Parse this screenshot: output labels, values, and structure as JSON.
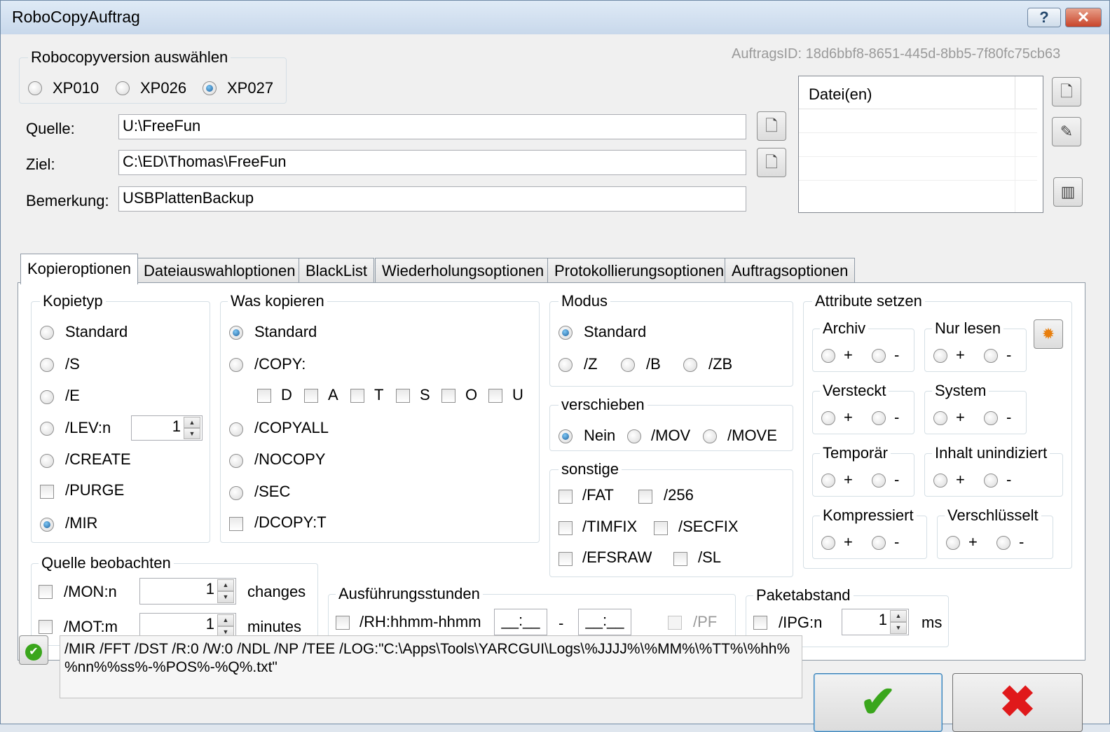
{
  "window": {
    "title": "RoboCopyAuftrag",
    "help_label": "?",
    "close_label": "✕"
  },
  "job_id": "AuftragsID: 18d6bbf8-8651-445d-8bb5-7f80fc75cb63",
  "version_group": {
    "label": "Robocopyversion auswählen",
    "options": [
      "XP010",
      "XP026",
      "XP027"
    ],
    "selected": "XP027"
  },
  "fields": {
    "source_label": "Quelle:",
    "source_value": "U:\\FreeFun",
    "target_label": "Ziel:",
    "target_value": "C:\\ED\\Thomas\\FreeFun",
    "remark_label": "Bemerkung:",
    "remark_value": "USBPlattenBackup"
  },
  "files": {
    "header": "Datei(en)"
  },
  "tabs": [
    "Kopieroptionen",
    "Dateiauswahloptionen",
    "BlackList",
    "Wiederholungsoptionen",
    "Protokollierungsoptionen",
    "Auftragsoptionen"
  ],
  "copy_type": {
    "label": "Kopietyp",
    "standard": "Standard",
    "s": "/S",
    "e": "/E",
    "lev": "/LEV:n",
    "lev_value": "1",
    "create": "/CREATE",
    "purge": "/PURGE",
    "mir": "/MIR",
    "selected": "/MIR"
  },
  "what_copy": {
    "label": "Was kopieren",
    "standard": "Standard",
    "copy": "/COPY:",
    "flags": [
      "D",
      "A",
      "T",
      "S",
      "O",
      "U"
    ],
    "copyall": "/COPYALL",
    "nocopy": "/NOCOPY",
    "sec": "/SEC",
    "dcopy": "/DCOPY:T",
    "selected": "Standard"
  },
  "mode": {
    "label": "Modus",
    "standard": "Standard",
    "z": "/Z",
    "b": "/B",
    "zb": "/ZB",
    "selected": "Standard"
  },
  "move": {
    "label": "verschieben",
    "nein": "Nein",
    "mov": "/MOV",
    "move": "/MOVE",
    "selected": "Nein"
  },
  "misc": {
    "label": "sonstige",
    "fat": "/FAT",
    "n256": "/256",
    "timfix": "/TIMFIX",
    "secfix": "/SECFIX",
    "efsraw": "/EFSRAW",
    "sl": "/SL"
  },
  "attributes": {
    "label": "Attribute setzen",
    "plus": "+",
    "minus": "-",
    "archiv": "Archiv",
    "readonly": "Nur lesen",
    "hidden": "Versteckt",
    "system": "System",
    "temp": "Temporär",
    "notindexed": "Inhalt unindiziert",
    "compressed": "Kompressiert",
    "encrypted": "Verschlüsselt",
    "reset_icon": "sparkle-icon"
  },
  "monitor": {
    "label": "Quelle beobachten",
    "mon": "/MON:n",
    "mon_value": "1",
    "mon_unit": "changes",
    "mot": "/MOT:m",
    "mot_value": "1",
    "mot_unit": "minutes"
  },
  "run_hours": {
    "label": "Ausführungsstunden",
    "rh": "/RH:hhmm-hhmm",
    "from": "__:__",
    "dash": "-",
    "to": "__:__",
    "pf": "/PF"
  },
  "packet": {
    "label": "Paketabstand",
    "ipg": "/IPG:n",
    "value": "1",
    "unit": "ms"
  },
  "command_line": "/MIR /FFT /DST /R:0 /W:0 /NDL /NP /TEE /LOG:\"C:\\Apps\\Tools\\YARCGUI\\Logs\\%JJJJ%\\%MM%\\%TT%\\%hh%%nn%%ss%-%POS%-%Q%.txt\"",
  "buttons": {
    "ok": "✔",
    "cancel": "✖"
  },
  "colors": {
    "ok": "#3aa61c",
    "cancel": "#e0191b",
    "title_bar": "#c8d8eb",
    "radio_checked": "#1d5f9c"
  }
}
